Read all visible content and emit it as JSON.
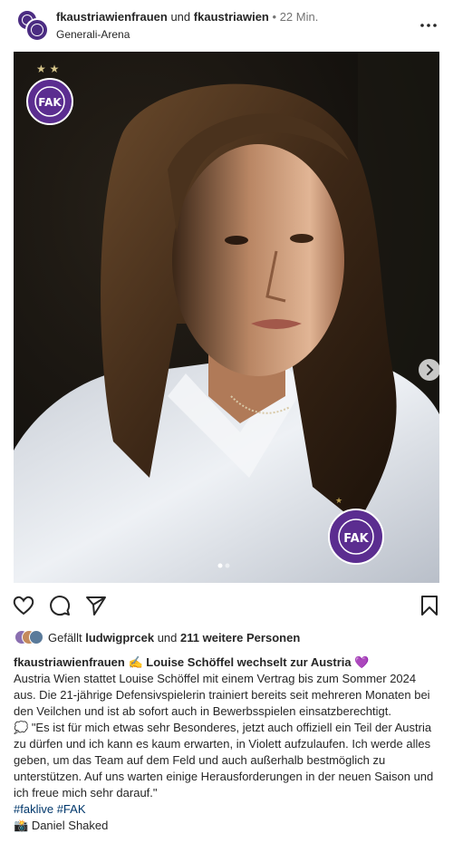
{
  "header": {
    "account_primary": "fkaustriawienfrauen",
    "connector": "und",
    "account_secondary": "fkaustriawien",
    "separator": "•",
    "time": "22 Min.",
    "location": "Generali-Arena",
    "more_icon": "more-horizontal-icon"
  },
  "post": {
    "image_alt": "Portrait of a young woman in a white FAK polo shirt",
    "badge_text": "FUSSBALLKLUB AUSTRIA WIEN",
    "badge_letters": "FAK",
    "carousel_count": 2,
    "carousel_active": 1
  },
  "actions": {
    "like_icon": "heart-icon",
    "comment_icon": "comment-icon",
    "share_icon": "send-icon",
    "save_icon": "bookmark-icon"
  },
  "likes": {
    "prefix": "Gefällt",
    "user": "ludwigprcek",
    "middle": "und",
    "count": "211 weitere Personen"
  },
  "caption": {
    "author": "fkaustriawienfrauen",
    "emoji1": "✍️",
    "headline": "Louise Schöffel wechselt zur Austria",
    "emoji2": "💜",
    "body1": "Austria Wien stattet Louise Schöffel mit einem Vertrag bis zum Sommer 2024 aus. Die 21-jährige Defensivspielerin trainiert bereits seit mehreren Monaten bei den Veilchen und ist ab sofort auch in Bewerbsspielen einsatzberechtigt.",
    "quote_emoji": "💭",
    "quote": "\"Es ist für mich etwas sehr Besonderes, jetzt auch offiziell ein Teil der Austria zu dürfen und ich kann es kaum erwarten, in Violett aufzulaufen. Ich werde alles geben, um das Team auf dem Feld und auch außerhalb bestmöglich zu unterstützen. Auf uns warten einige Herausforderungen in der neuen Saison und ich freue mich sehr darauf.\"",
    "hashtags": "#faklive #FAK",
    "camera_emoji": "📸",
    "credit": "Daniel Shaked"
  },
  "colors": {
    "brand_purple": "#5b2d90",
    "link": "#00376b",
    "muted": "#737373"
  }
}
